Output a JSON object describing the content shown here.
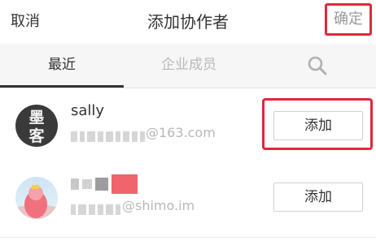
{
  "header": {
    "cancel_label": "取消",
    "title": "添加协作者",
    "confirm_label": "确定"
  },
  "tabs": {
    "recent_label": "最近",
    "members_label": "企业成员",
    "search_icon": "search-icon"
  },
  "users": [
    {
      "name": "sally",
      "email_domain": "@163.com",
      "add_label": "添加",
      "avatar_chars": [
        "墨",
        "客"
      ]
    },
    {
      "name": "",
      "email_domain": "@shimo.im",
      "add_label": "添加"
    }
  ],
  "colors": {
    "highlight": "#e0283c",
    "active_tab": "#333333",
    "inactive_tab": "#b9b9b9"
  }
}
